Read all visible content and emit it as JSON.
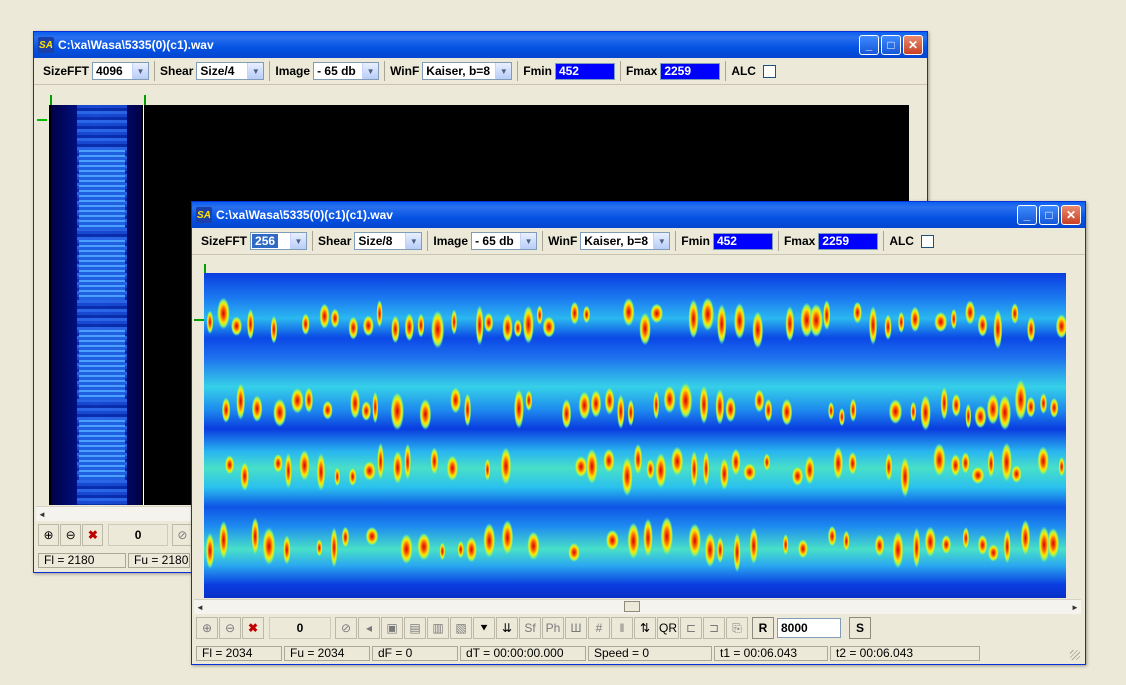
{
  "back_window": {
    "title": "C:\\xa\\Wasa\\5335(0)(c1).wav",
    "app_icon_text": "SA",
    "toolbar": {
      "sizefft_label": "SizeFFT",
      "sizefft_value": "4096",
      "shear_label": "Shear",
      "shear_value": "Size/4",
      "image_label": "Image",
      "image_value": "- 65 db",
      "winf_label": "WinF",
      "winf_value": "Kaiser, b=8",
      "fmin_label": "Fmin",
      "fmin_value": "452",
      "fmax_label": "Fmax",
      "fmax_value": "2259",
      "alc_label": "ALC"
    },
    "counter": "0",
    "status": {
      "fl": "Fl = 2180",
      "fu": "Fu = 2180"
    }
  },
  "front_window": {
    "title": "C:\\xa\\Wasa\\5335(0)(c1)(c1).wav",
    "app_icon_text": "SA",
    "toolbar": {
      "sizefft_label": "SizeFFT",
      "sizefft_value": "256",
      "shear_label": "Shear",
      "shear_value": "Size/8",
      "image_label": "Image",
      "image_value": "- 65 db",
      "winf_label": "WinF",
      "winf_value": "Kaiser, b=8",
      "fmin_label": "Fmin",
      "fmin_value": "452",
      "fmax_label": "Fmax",
      "fmax_value": "2259",
      "alc_label": "ALC"
    },
    "counter": "0",
    "buttons": {
      "r_label": "R",
      "rate_value": "8000",
      "s_label": "S",
      "sf_label": "Sf",
      "ph_label": "Ph"
    },
    "status": {
      "fl": "Fl = 2034",
      "fu": "Fu = 2034",
      "df": "dF = 0",
      "dt": "dT = 00:00:00.000",
      "speed": "Speed = 0",
      "t1": "t1 = 00:06.043",
      "t2": "t2 = 00:06.043"
    }
  },
  "colors": {
    "titlebar": "#0553e3",
    "field_blue": "#0000ff",
    "window_bg": "#ece9d8"
  }
}
